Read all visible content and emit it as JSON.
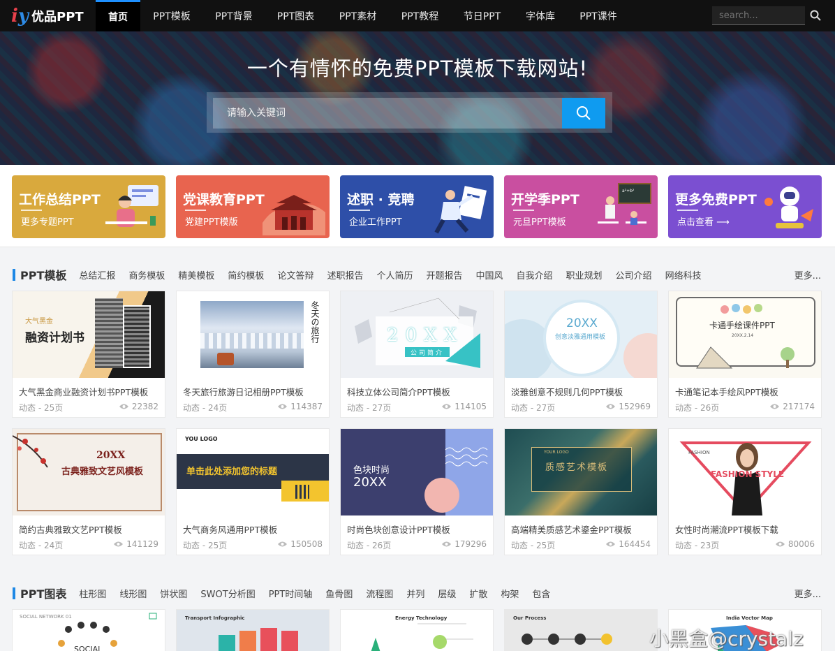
{
  "nav": {
    "logo_text": "优品PPT",
    "items": [
      "首页",
      "PPT模板",
      "PPT背景",
      "PPT图表",
      "PPT素材",
      "PPT教程",
      "节日PPT",
      "字体库",
      "PPT课件"
    ],
    "search_placeholder": "search..."
  },
  "hero": {
    "title": "一个有情怀的免费PPT模板下载网站!",
    "search_placeholder": "请输入关键词"
  },
  "banners": [
    {
      "title": "工作总结PPT",
      "sub": "更多专题PPT",
      "color": "#d9a93d"
    },
    {
      "title": "党课教育PPT",
      "sub": "党建PPT模版",
      "color": "#e8644f"
    },
    {
      "title": "述职 · 竞聘",
      "sub": "企业工作PPT",
      "color": "#2e4fa8"
    },
    {
      "title": "开学季PPT",
      "sub": "元旦PPT模板",
      "color": "#c94fa0"
    },
    {
      "title": "更多免费PPT",
      "sub": "点击查看 ⟶",
      "color": "#7b4fd1"
    }
  ],
  "ppt_section": {
    "title": "PPT模板",
    "tags": [
      "总结汇报",
      "商务模板",
      "精美模板",
      "简约模板",
      "论文答辩",
      "述职报告",
      "个人简历",
      "开题报告",
      "中国风",
      "自我介绍",
      "职业规划",
      "公司介绍",
      "网络科技"
    ],
    "more": "更多...",
    "cards": [
      {
        "title": "大气黑金商业融资计划书PPT模板",
        "meta": "动态 - 25页",
        "views": "22382",
        "thumb_text": "融资计划书",
        "thumb_small": "大气黑金"
      },
      {
        "title": "冬天旅行旅游日记相册PPT模板",
        "meta": "动态 - 24页",
        "views": "114387",
        "thumb_text": "冬天の旅行"
      },
      {
        "title": "科技立体公司简介PPT模板",
        "meta": "动态 - 27页",
        "views": "114105",
        "thumb_text": "20XX",
        "thumb_small": "公司简介"
      },
      {
        "title": "淡雅创意不规则几何PPT模板",
        "meta": "动态 - 27页",
        "views": "152969",
        "thumb_text": "20XX",
        "thumb_small": "创意淡雅通用模板"
      },
      {
        "title": "卡通笔记本手绘风PPT模板",
        "meta": "动态 - 26页",
        "views": "217174",
        "thumb_text": "卡通手绘课件PPT",
        "thumb_small": "20XX.2.14"
      },
      {
        "title": "简约古典雅致文艺PPT模板",
        "meta": "动态 - 24页",
        "views": "141129",
        "thumb_text": "古典雅致文艺风模板",
        "thumb_small": "20XX"
      },
      {
        "title": "大气商务风通用PPT模板",
        "meta": "动态 - 25页",
        "views": "150508",
        "thumb_text": "单击此处添加您的标题",
        "thumb_small": "YOU LOGO"
      },
      {
        "title": "时尚色块创意设计PPT模板",
        "meta": "动态 - 26页",
        "views": "179296",
        "thumb_text": "色块时尚",
        "thumb_small": "20XX"
      },
      {
        "title": "高端精美质感艺术鎏金PPT模板",
        "meta": "动态 - 25页",
        "views": "164454",
        "thumb_text": "质感艺术模板",
        "thumb_small": "YOUR LOGO"
      },
      {
        "title": "女性时尚潮流PPT模板下载",
        "meta": "动态 - 23页",
        "views": "80006",
        "thumb_text": "FASHION STYLE",
        "thumb_small": "FASHION"
      }
    ]
  },
  "chart_section": {
    "title": "PPT图表",
    "tags": [
      "柱形图",
      "线形图",
      "饼状图",
      "SWOT分析图",
      "PPT时间轴",
      "鱼骨图",
      "流程图",
      "并列",
      "层级",
      "扩散",
      "构架",
      "包含"
    ],
    "more": "更多...",
    "cards": [
      {
        "label": "SOCIAL NETWORK 01",
        "word": "SOCIAL"
      },
      {
        "label": "Transport Infographic"
      },
      {
        "label": "Energy Technology"
      },
      {
        "label": "Our Process"
      },
      {
        "label": "India Vector Map"
      }
    ]
  },
  "watermark": "小黑盒@crystalz"
}
